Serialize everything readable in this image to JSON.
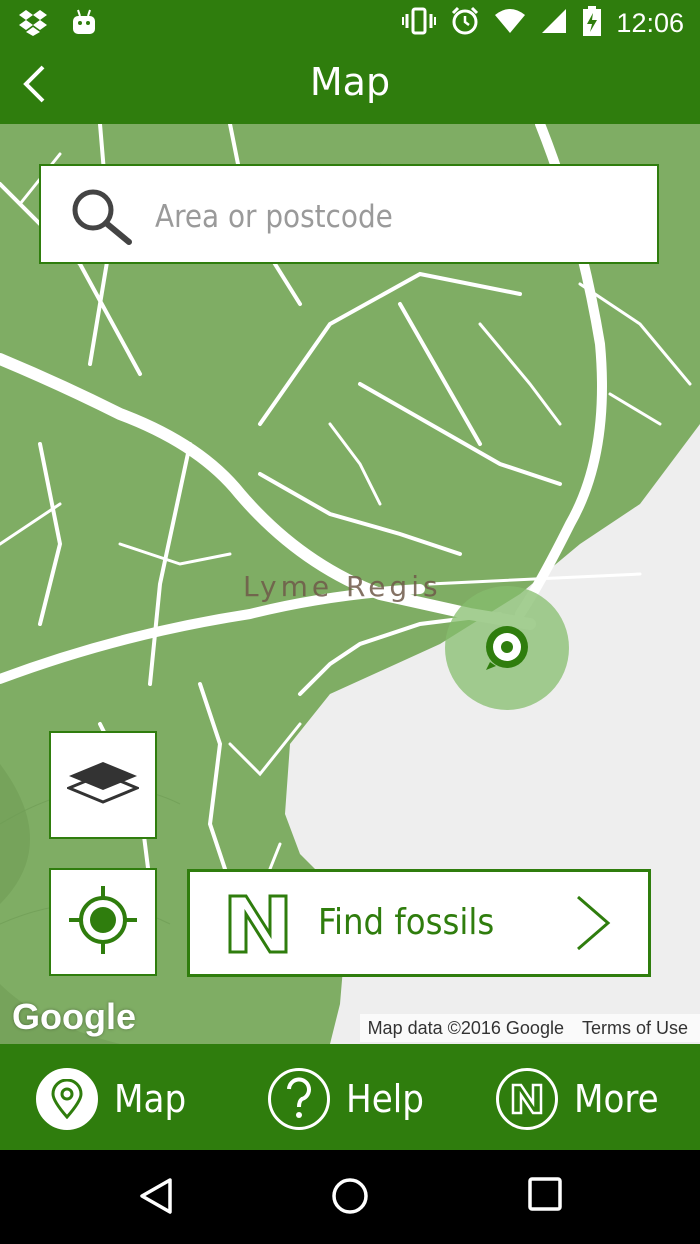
{
  "status_bar": {
    "time": "12:06",
    "icons": [
      "dropbox-icon",
      "android-debug-icon",
      "vibrate-icon",
      "alarm-icon",
      "wifi-icon",
      "signal-icon",
      "battery-charging-icon"
    ]
  },
  "app_bar": {
    "title": "Map",
    "back_icon": "back-chevron-icon"
  },
  "map": {
    "search": {
      "placeholder": "Area or postcode",
      "value": ""
    },
    "place_label": "Lyme Regis",
    "find_button": {
      "label": "Find fossils"
    },
    "google_logo": "Google",
    "attribution": {
      "data": "Map data ©2016 Google",
      "terms": "Terms of Use"
    },
    "colors": {
      "land": "#7fad64",
      "sea": "#eeeeee",
      "road": "#ffffff",
      "accent": "#2f7d0d"
    }
  },
  "bottom_nav": {
    "items": [
      {
        "label": "Map",
        "icon": "map-pin-icon",
        "active": true
      },
      {
        "label": "Help",
        "icon": "question-icon",
        "active": false
      },
      {
        "label": "More",
        "icon": "n-logo-icon",
        "active": false
      }
    ]
  },
  "system_nav": {
    "icons": [
      "back-triangle-icon",
      "home-circle-icon",
      "recents-square-icon"
    ]
  }
}
